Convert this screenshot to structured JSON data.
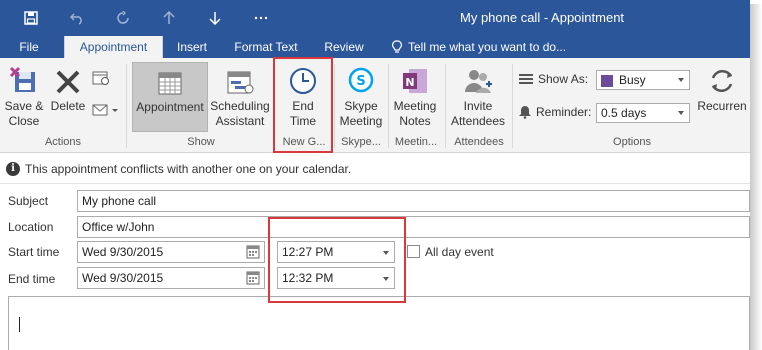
{
  "window": {
    "title": "My phone call - Appointment"
  },
  "qat": [
    {
      "icon": "save-icon"
    },
    {
      "icon": "undo-icon"
    },
    {
      "icon": "redo-icon"
    },
    {
      "icon": "up-arrow-icon"
    },
    {
      "icon": "down-arrow-icon"
    },
    {
      "icon": "more-icon"
    }
  ],
  "tabs": {
    "file": "File",
    "appointment": "Appointment",
    "insert": "Insert",
    "format_text": "Format Text",
    "review": "Review",
    "tell_me": "Tell me what you want to do..."
  },
  "ribbon": {
    "save_close": [
      "Save &",
      "Close"
    ],
    "delete": "Delete",
    "appointment": "Appointment",
    "scheduling": [
      "Scheduling",
      "Assistant"
    ],
    "end_time": [
      "End",
      "Time"
    ],
    "skype": [
      "Skype",
      "Meeting"
    ],
    "meeting_notes": [
      "Meeting",
      "Notes"
    ],
    "invite": [
      "Invite",
      "Attendees"
    ],
    "show_as_label": "Show As:",
    "show_as_value": "Busy",
    "reminder_label": "Reminder:",
    "reminder_value": "0.5 days",
    "recurrence": "Recurren",
    "groups": {
      "actions": "Actions",
      "show": "Show",
      "new_group": "New G...",
      "skype": "Skype...",
      "meeting": "Meetin...",
      "attendees": "Attendees",
      "options": "Options"
    }
  },
  "info": {
    "message": "This appointment conflicts with another one on your calendar."
  },
  "form": {
    "subject_label": "Subject",
    "subject_value": "My phone call",
    "location_label": "Location",
    "location_value": "Office w/John",
    "start_label": "Start time",
    "start_date": "Wed 9/30/2015",
    "start_time": "12:27 PM",
    "all_day_label": "All day event",
    "all_day_checked": false,
    "end_label": "End time",
    "end_date": "Wed 9/30/2015",
    "end_time": "12:32 PM"
  },
  "colors": {
    "accent": "#2b579a",
    "highlight": "#d9393c",
    "busy_swatch": "#6b4c9a"
  }
}
